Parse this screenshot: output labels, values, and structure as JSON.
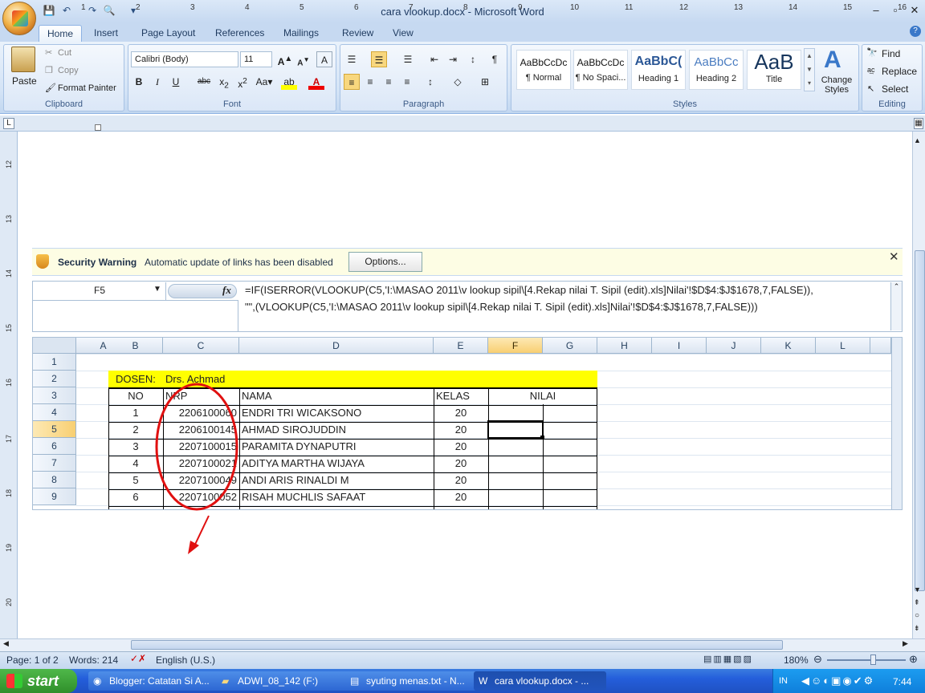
{
  "window": {
    "title": "cara vlookup.docx - Microsoft Word"
  },
  "tabs": [
    "Home",
    "Insert",
    "Page Layout",
    "References",
    "Mailings",
    "Review",
    "View"
  ],
  "clipboard": {
    "paste": "Paste",
    "cut": "Cut",
    "copy": "Copy",
    "format_painter": "Format Painter",
    "label": "Clipboard"
  },
  "font": {
    "name": "Calibri (Body)",
    "size": "11",
    "label": "Font"
  },
  "paragraph": {
    "label": "Paragraph"
  },
  "styles": {
    "items": [
      {
        "preview": "AaBbCcDc",
        "name": "¶ Normal"
      },
      {
        "preview": "AaBbCcDc",
        "name": "¶ No Spaci..."
      },
      {
        "preview": "AaBbC(",
        "name": "Heading 1"
      },
      {
        "preview": "AaBbCc",
        "name": "Heading 2"
      },
      {
        "preview": "AaB",
        "name": "Title"
      }
    ],
    "change": "Change Styles",
    "label": "Styles"
  },
  "editing": {
    "find": "Find",
    "replace": "Replace",
    "select": "Select",
    "label": "Editing"
  },
  "ruler_numbers": [
    "1",
    "2",
    "3",
    "4",
    "5",
    "6",
    "7",
    "8",
    "9",
    "10",
    "11",
    "12",
    "13",
    "14",
    "15",
    "16"
  ],
  "vruler_numbers": [
    "12",
    "13",
    "14",
    "15",
    "16",
    "17",
    "18",
    "19",
    "20"
  ],
  "security": {
    "title": "Security Warning",
    "message": "Automatic update of links has been disabled",
    "button": "Options..."
  },
  "formula_bar": {
    "cell_ref": "F5",
    "fx": "fx",
    "line1": "=IF(ISERROR(VLOOKUP(C5,'I:\\MASAO 2011\\v lookup sipil\\[4.Rekap nilai T. Sipil (edit).xls]Nilai'!$D$4:$J$1678,7,FALSE)),",
    "line2": "\"\",(VLOOKUP(C5,'I:\\MASAO 2011\\v lookup sipil\\[4.Rekap nilai T. Sipil (edit).xls]Nilai'!$D$4:$J$1678,7,FALSE)))"
  },
  "sheet": {
    "columns": [
      "A",
      "B",
      "C",
      "D",
      "E",
      "F",
      "G",
      "H",
      "I",
      "J",
      "K",
      "L"
    ],
    "rows": [
      "1",
      "2",
      "3",
      "4",
      "5",
      "6",
      "7",
      "8",
      "9"
    ],
    "dosen_label": "DOSEN:",
    "dosen_name": "Drs. Achmad",
    "headers": {
      "no": "NO",
      "nrp": "NRP",
      "nama": "NAMA",
      "kelas": "KELAS",
      "nilai": "NILAI"
    },
    "students": [
      {
        "no": "1",
        "nrp": "2206100060",
        "nama": "ENDRI  TRI  WICAKSONO",
        "kelas": "20"
      },
      {
        "no": "2",
        "nrp": "2206100145",
        "nama": "AHMAD SIROJUDDIN",
        "kelas": "20"
      },
      {
        "no": "3",
        "nrp": "2207100015",
        "nama": "PARAMITA DYNAPUTRI",
        "kelas": "20"
      },
      {
        "no": "4",
        "nrp": "2207100021",
        "nama": "ADITYA MARTHA WIJAYA",
        "kelas": "20"
      },
      {
        "no": "5",
        "nrp": "2207100049",
        "nama": "ANDI ARIS RINALDI M",
        "kelas": "20"
      },
      {
        "no": "6",
        "nrp": "2207100052",
        "nama": "RISAH MUCHLIS SAFAAT",
        "kelas": "20"
      }
    ]
  },
  "status": {
    "page": "Page: 1 of 2",
    "words": "Words: 214",
    "language": "English (U.S.)",
    "zoom": "180%"
  },
  "taskbar": {
    "start": "start",
    "tasks": [
      "Blogger: Catatan Si A...",
      "ADWI_08_142 (F:)",
      "syuting menas.txt - N...",
      "cara vlookup.docx - ..."
    ],
    "lang": "IN",
    "clock": "7:44"
  }
}
